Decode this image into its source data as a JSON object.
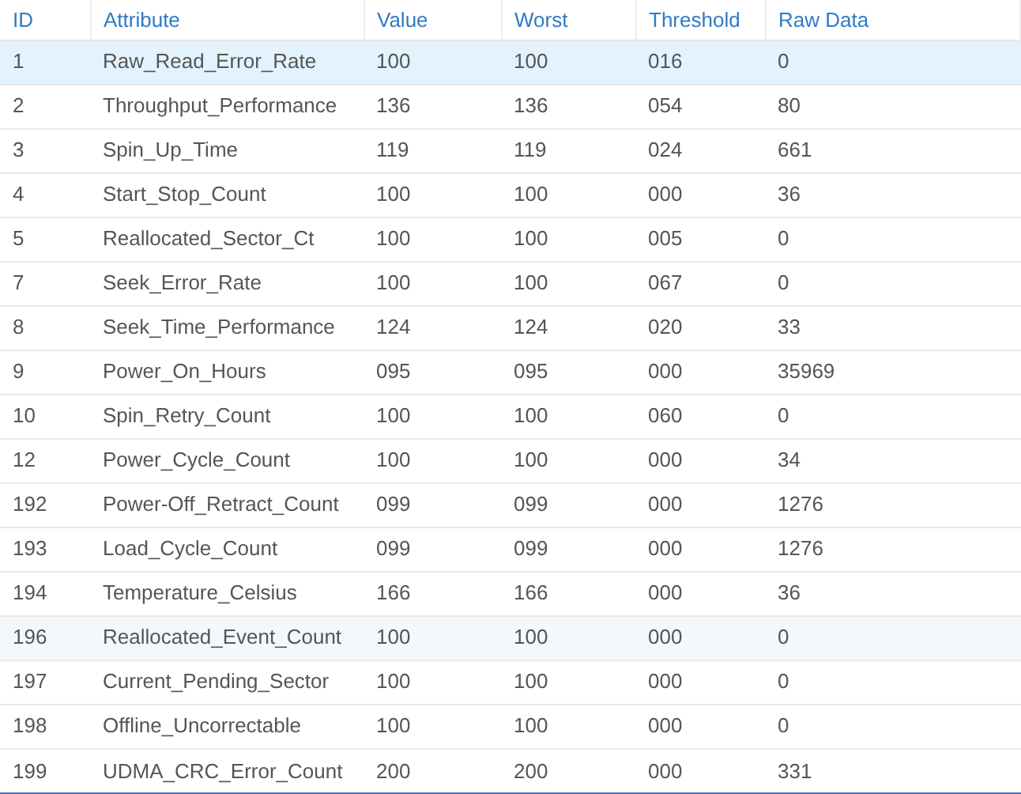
{
  "table": {
    "columns": [
      "ID",
      "Attribute",
      "Value",
      "Worst",
      "Threshold",
      "Raw Data"
    ],
    "rows": [
      {
        "cells": [
          "1",
          "Raw_Read_Error_Rate",
          "100",
          "100",
          "016",
          "0"
        ],
        "selected": true,
        "hovered": false
      },
      {
        "cells": [
          "2",
          "Throughput_Performance",
          "136",
          "136",
          "054",
          "80"
        ],
        "selected": false,
        "hovered": false
      },
      {
        "cells": [
          "3",
          "Spin_Up_Time",
          "119",
          "119",
          "024",
          "661"
        ],
        "selected": false,
        "hovered": false
      },
      {
        "cells": [
          "4",
          "Start_Stop_Count",
          "100",
          "100",
          "000",
          "36"
        ],
        "selected": false,
        "hovered": false
      },
      {
        "cells": [
          "5",
          "Reallocated_Sector_Ct",
          "100",
          "100",
          "005",
          "0"
        ],
        "selected": false,
        "hovered": false
      },
      {
        "cells": [
          "7",
          "Seek_Error_Rate",
          "100",
          "100",
          "067",
          "0"
        ],
        "selected": false,
        "hovered": false
      },
      {
        "cells": [
          "8",
          "Seek_Time_Performance",
          "124",
          "124",
          "020",
          "33"
        ],
        "selected": false,
        "hovered": false
      },
      {
        "cells": [
          "9",
          "Power_On_Hours",
          "095",
          "095",
          "000",
          "35969"
        ],
        "selected": false,
        "hovered": false
      },
      {
        "cells": [
          "10",
          "Spin_Retry_Count",
          "100",
          "100",
          "060",
          "0"
        ],
        "selected": false,
        "hovered": false
      },
      {
        "cells": [
          "12",
          "Power_Cycle_Count",
          "100",
          "100",
          "000",
          "34"
        ],
        "selected": false,
        "hovered": false
      },
      {
        "cells": [
          "192",
          "Power-Off_Retract_Count",
          "099",
          "099",
          "000",
          "1276"
        ],
        "selected": false,
        "hovered": false
      },
      {
        "cells": [
          "193",
          "Load_Cycle_Count",
          "099",
          "099",
          "000",
          "1276"
        ],
        "selected": false,
        "hovered": false
      },
      {
        "cells": [
          "194",
          "Temperature_Celsius",
          "166",
          "166",
          "000",
          "36"
        ],
        "selected": false,
        "hovered": false
      },
      {
        "cells": [
          "196",
          "Reallocated_Event_Count",
          "100",
          "100",
          "000",
          "0"
        ],
        "selected": false,
        "hovered": true
      },
      {
        "cells": [
          "197",
          "Current_Pending_Sector",
          "100",
          "100",
          "000",
          "0"
        ],
        "selected": false,
        "hovered": false
      },
      {
        "cells": [
          "198",
          "Offline_Uncorrectable",
          "100",
          "100",
          "000",
          "0"
        ],
        "selected": false,
        "hovered": false
      },
      {
        "cells": [
          "199",
          "UDMA_CRC_Error_Count",
          "200",
          "200",
          "000",
          "331"
        ],
        "selected": false,
        "hovered": false
      }
    ]
  }
}
